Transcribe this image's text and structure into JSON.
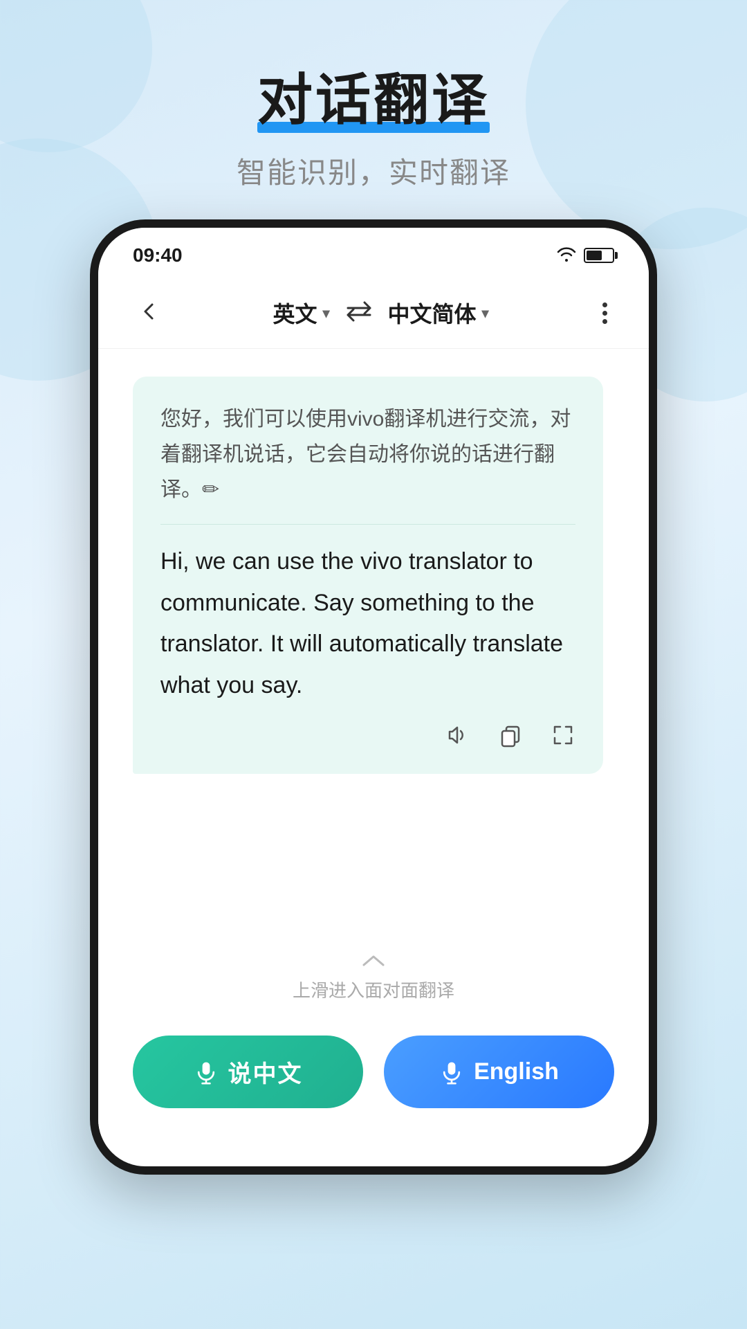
{
  "page": {
    "background_color": "#d6eaf8"
  },
  "header": {
    "title": "对话翻译",
    "subtitle": "智能识别，实时翻译"
  },
  "status_bar": {
    "time": "09:40",
    "wifi": "wifi",
    "battery": "battery"
  },
  "app_header": {
    "back_label": "‹",
    "source_lang": "英文",
    "source_lang_arrow": "▾",
    "swap_icon": "⇄",
    "target_lang": "中文简体",
    "target_lang_arrow": "▾",
    "more_icon": "more"
  },
  "chat": {
    "bubble": {
      "original_text": "您好，我们可以使用vivo翻译机进行交流，对着翻译机说话，它会自动将你说的话进行翻译。✏",
      "translated_text": "Hi, we can use the vivo translator to communicate. Say something to the translator. It will  automatically translate what you say.",
      "action_sound": "sound",
      "action_copy": "copy",
      "action_expand": "expand"
    }
  },
  "bottom_hint": {
    "arrow": "∧",
    "text": "上滑进入面对面翻译"
  },
  "buttons": {
    "chinese_label": "说中文",
    "english_label": "English"
  }
}
